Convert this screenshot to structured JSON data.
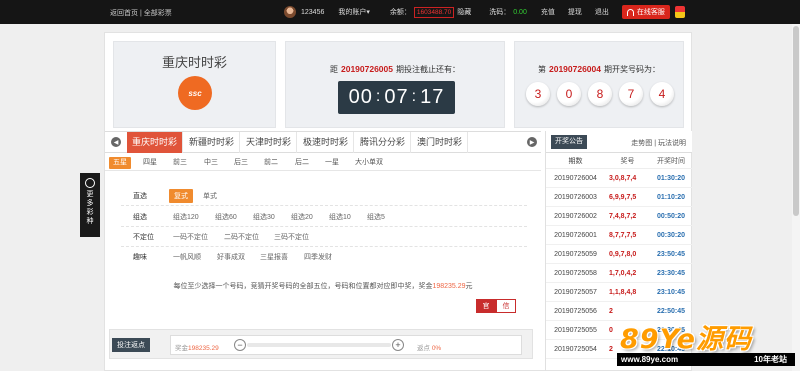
{
  "topbar": {
    "home": "返回首页",
    "all_lottery": "全部彩票",
    "divider": "|",
    "username": "123456",
    "account": "我的账户",
    "account_caret": "▾",
    "balance_label": "余额：",
    "balance_value": "1603488.70",
    "hide_label": "隐藏",
    "wash_label": "洗码：",
    "wash_value": "0.00",
    "recharge": "充值",
    "withdraw": "提现",
    "logout": "退出",
    "service": "在线客服"
  },
  "lottery": {
    "name": "重庆时时彩",
    "logo_text": "ssc"
  },
  "countdown": {
    "prefix": "距",
    "issue": "20190726005",
    "suffix": "期投注截止还有：",
    "hh": "00",
    "mm": "07",
    "ss": "17",
    "sep": ":"
  },
  "draw": {
    "prefix": "第",
    "issue": "20190726004",
    "suffix": "期开奖号码为：",
    "numbers": [
      "3",
      "0",
      "8",
      "7",
      "4"
    ]
  },
  "tabs": [
    "重庆时时彩",
    "新疆时时彩",
    "天津时时彩",
    "极速时时彩",
    "腾讯分分彩",
    "澳门时时彩"
  ],
  "subtabs": [
    "五星",
    "四星",
    "前三",
    "中三",
    "后三",
    "前二",
    "后二",
    "一星",
    "大小单双"
  ],
  "play": {
    "direct_label": "直选",
    "direct_opts": [
      "复式",
      "单式"
    ],
    "group_label": "组选",
    "group_opts": [
      "组选120",
      "组选60",
      "组选30",
      "组选20",
      "组选10",
      "组选5"
    ],
    "undetermined_label": "不定位",
    "undetermined_opts": [
      "一码不定位",
      "二码不定位",
      "三码不定位"
    ],
    "fun_label": "趣味",
    "fun_opts": [
      "一帆风顺",
      "好事成双",
      "三星报喜",
      "四季发财"
    ]
  },
  "description": {
    "text": "每位至少选择一个号码，竞猜开奖号码的全部五位，号码和位置都对应即中奖，奖金",
    "prize": "198235.29",
    "unit": "元"
  },
  "mode": {
    "official": "官",
    "credit": "信"
  },
  "bet": {
    "rebate_btn": "投注返点",
    "bonus_label": "奖金",
    "bonus_value": "198235.29",
    "rebate_label": "返点",
    "rebate_value": "0%",
    "minus": "−",
    "plus": "+"
  },
  "side": {
    "tab": "开奖公告",
    "trend": "走势图",
    "divider": "|",
    "rules": "玩法说明",
    "headers": [
      "期数",
      "奖号",
      "开奖时间"
    ],
    "rows": [
      [
        "20190726004",
        "3,0,8,7,4",
        "01:30:20"
      ],
      [
        "20190726003",
        "6,9,9,7,5",
        "01:10:20"
      ],
      [
        "20190726002",
        "7,4,8,7,2",
        "00:50:20"
      ],
      [
        "20190726001",
        "8,7,7,7,5",
        "00:30:20"
      ],
      [
        "20190725059",
        "0,9,7,8,0",
        "23:50:45"
      ],
      [
        "20190725058",
        "1,7,0,4,2",
        "23:30:45"
      ],
      [
        "20190725057",
        "1,1,8,4,8",
        "23:10:45"
      ],
      [
        "20190725056",
        "2",
        "22:50:45"
      ],
      [
        "20190725055",
        "0",
        "22:30:45"
      ],
      [
        "20190725054",
        "2",
        "22:10:45"
      ]
    ]
  },
  "more_lotto": "更多彩种",
  "watermark": {
    "brand": "89Ye源码",
    "domain": "www.89ye.com",
    "tag": "10年老站"
  }
}
